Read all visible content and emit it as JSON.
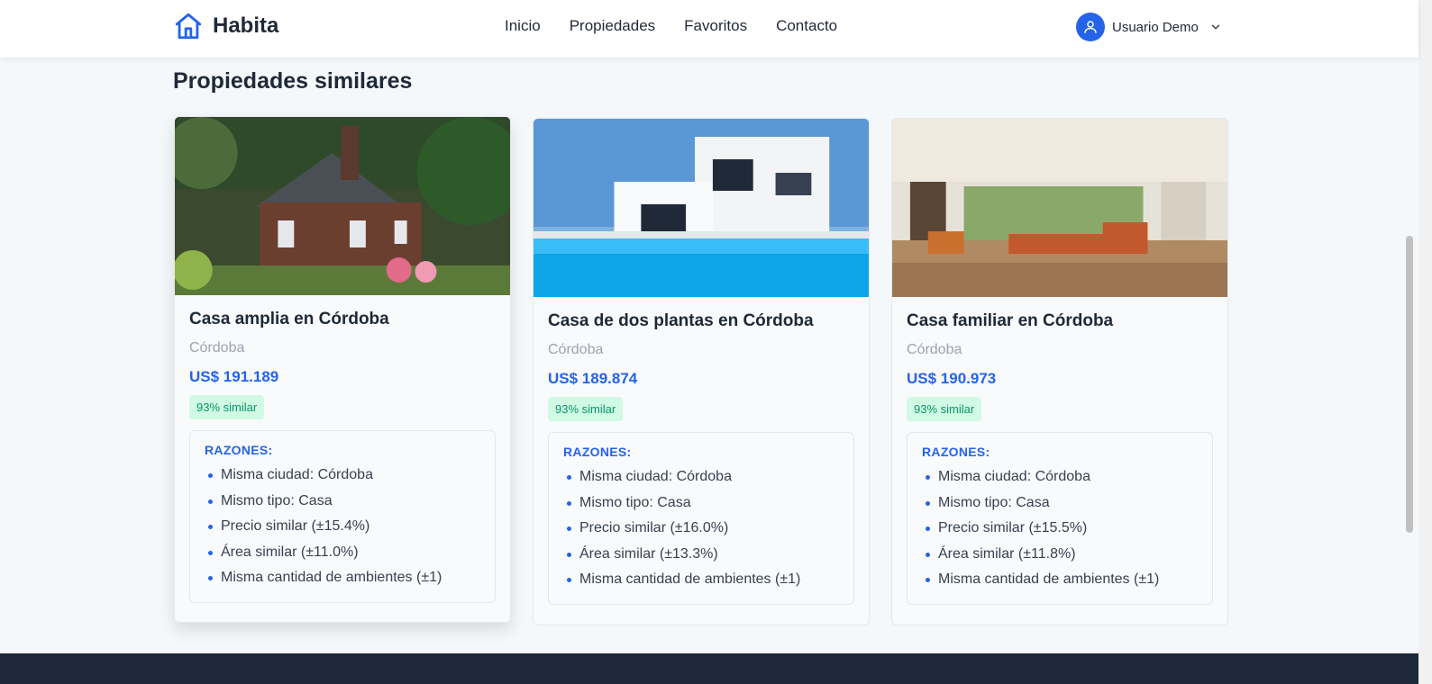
{
  "brand": {
    "name": "Habita"
  },
  "nav": {
    "links": [
      "Inicio",
      "Propiedades",
      "Favoritos",
      "Contacto"
    ]
  },
  "user": {
    "name": "Usuario Demo"
  },
  "section": {
    "title": "Propiedades similares"
  },
  "reasons_label": "RAZONES:",
  "colors": {
    "accent": "#2563eb",
    "badge_bg": "#d1fae5",
    "badge_text": "#059669",
    "footer": "#1e293b"
  },
  "cards": [
    {
      "title": "Casa amplia en Córdoba",
      "city": "Córdoba",
      "price": "US$ 191.189",
      "similarity": "93% similar",
      "image": "stone-cottage-garden",
      "reasons": [
        "Misma ciudad: Córdoba",
        "Mismo tipo: Casa",
        "Precio similar (±15.4%)",
        "Área similar (±11.0%)",
        "Misma cantidad de ambientes (±1)"
      ]
    },
    {
      "title": "Casa de dos plantas en Córdoba",
      "city": "Córdoba",
      "price": "US$ 189.874",
      "similarity": "93% similar",
      "image": "modern-house-pool",
      "reasons": [
        "Misma ciudad: Córdoba",
        "Mismo tipo: Casa",
        "Precio similar (±16.0%)",
        "Área similar (±13.3%)",
        "Misma cantidad de ambientes (±1)"
      ]
    },
    {
      "title": "Casa familiar en Córdoba",
      "city": "Córdoba",
      "price": "US$ 190.973",
      "similarity": "93% similar",
      "image": "living-room-interior",
      "reasons": [
        "Misma ciudad: Córdoba",
        "Mismo tipo: Casa",
        "Precio similar (±15.5%)",
        "Área similar (±11.8%)",
        "Misma cantidad de ambientes (±1)"
      ]
    }
  ]
}
